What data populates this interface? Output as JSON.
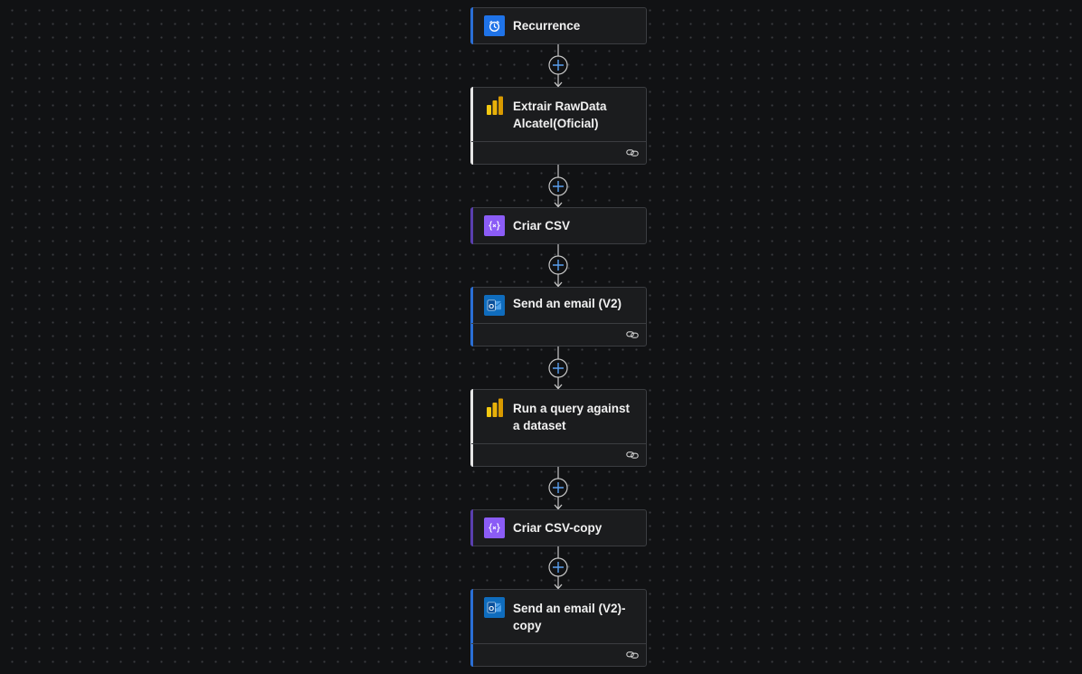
{
  "flow": {
    "steps": [
      {
        "id": "recurrence",
        "title": "Recurrence",
        "icon": "clock-icon",
        "icon_bg": "#1f73e8",
        "accent": "#2a6fd6",
        "has_footer": false
      },
      {
        "id": "extrair",
        "title": "Extrair RawData Alcatel(Oficial)",
        "icon": "powerbi-icon",
        "icon_bg": "transparent",
        "accent": "#e6e6e6",
        "has_footer": true
      },
      {
        "id": "criar-csv",
        "title": "Criar CSV",
        "icon": "data-operation-icon",
        "icon_bg": "#8b5cf6",
        "accent": "#5a3fb0",
        "has_footer": false
      },
      {
        "id": "send-email",
        "title": "Send an email (V2)",
        "icon": "outlook-icon",
        "icon_bg": "#0f6cbd",
        "accent": "#2a6fd6",
        "has_footer": true
      },
      {
        "id": "run-query",
        "title": "Run a query against a dataset",
        "icon": "powerbi-icon",
        "icon_bg": "transparent",
        "accent": "#e6e6e6",
        "has_footer": true
      },
      {
        "id": "criar-csv-copy",
        "title": "Criar CSV-copy",
        "icon": "data-operation-icon",
        "icon_bg": "#8b5cf6",
        "accent": "#5a3fb0",
        "has_footer": false
      },
      {
        "id": "send-email-copy",
        "title": "Send an email (V2)-copy",
        "icon": "outlook-icon",
        "icon_bg": "#0f6cbd",
        "accent": "#2a6fd6",
        "has_footer": true
      }
    ]
  },
  "colors": {
    "canvas": "#111214",
    "card": "#1b1c1e",
    "connector": "#c8c8c8",
    "add_button_plus": "#5aa0f0"
  }
}
